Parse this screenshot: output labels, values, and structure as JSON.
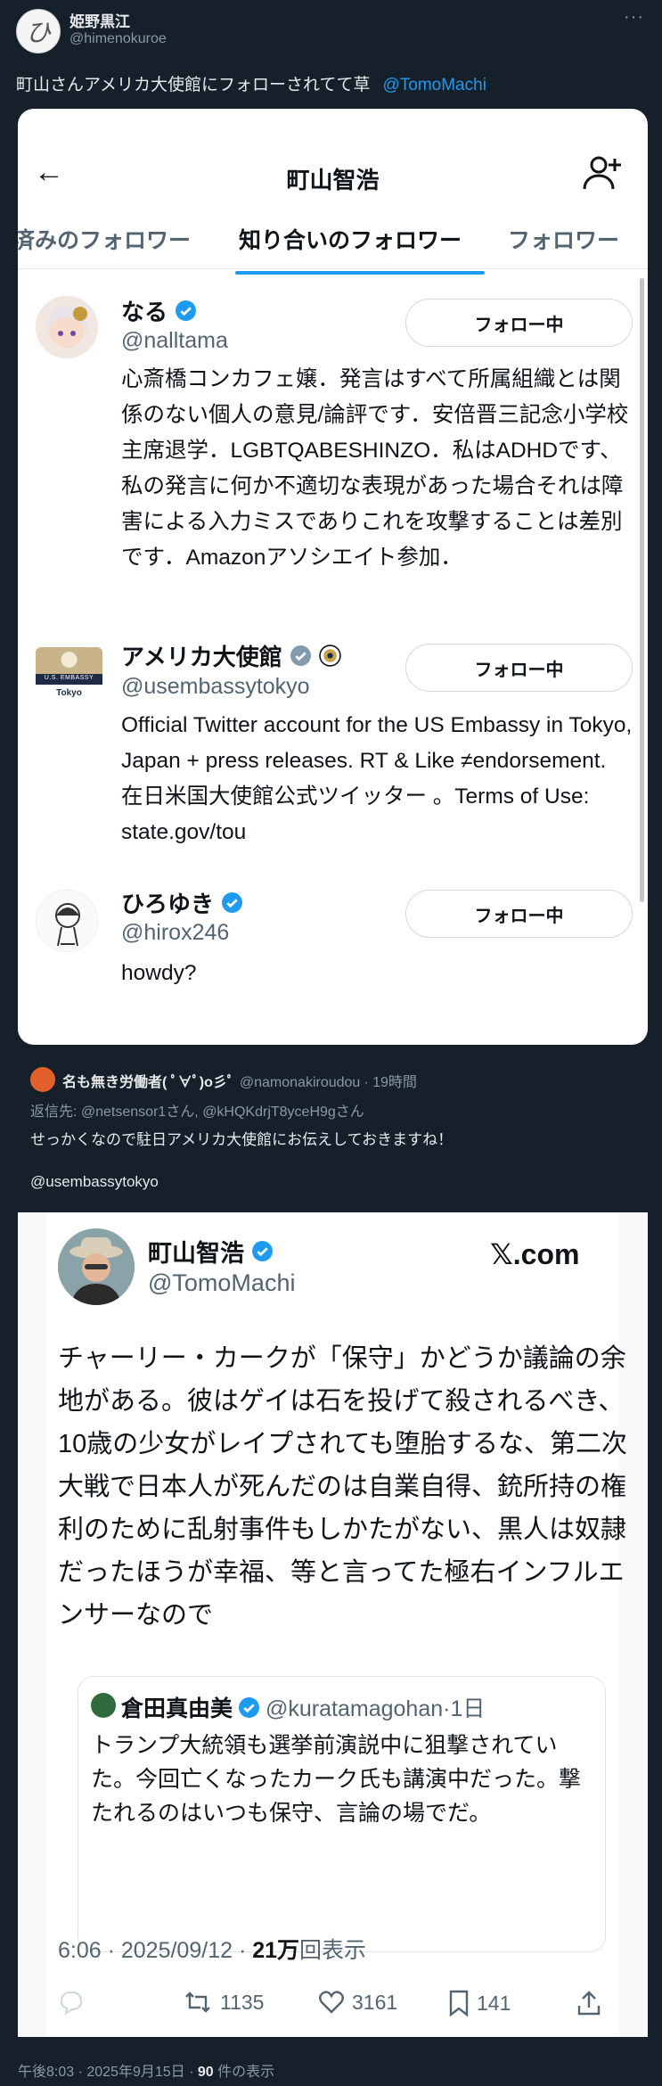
{
  "post": {
    "author_name": "姫野黒江",
    "author_handle": "@himenokuroe",
    "avatar_glyph": "ひ",
    "more": "···",
    "text": "町山さんアメリカ大使館にフォローされてて草",
    "mention": "@TomoMachi"
  },
  "screenshot1": {
    "title": "町山智浩",
    "back_icon": "←",
    "tabs": [
      "済みのフォロワー",
      "知り合いのフォロワー",
      "フォロワー"
    ],
    "accounts": [
      {
        "name": "なる",
        "handle": "@nalltama",
        "button": "フォロー中",
        "bio": "心斎橋コンカフェ嬢．発言はすべて所属組織とは関係のない個人の意見/論評です．安倍晋三記念小学校主席退学．LGBTQABESHINZO．私はADHDです、私の発言に何か不適切な表現があった場合それは障害による入力ミスでありこれを攻撃することは差別です．Amazonアソシエイト参加．"
      },
      {
        "name": "アメリカ大使館",
        "handle": "@usembassytokyo",
        "button": "フォロー中",
        "avatar_text": "U.S. EMBASSY",
        "avatar_sub": "Tokyo",
        "bio": "Official Twitter account for the US Embassy in Tokyo, Japan + press releases. RT & Like ≠endorsement. 在日米国大使館公式ツイッター 。Terms of Use: state.gov/tou"
      },
      {
        "name": "ひろゆき",
        "handle": "@hirox246",
        "button": "フォロー中",
        "bio": "howdy?"
      }
    ]
  },
  "reply": {
    "author_name": "名も無き労働者( ﾟ∀ﾟ)o彡ﾟ",
    "author_handle": "@namonakiroudou",
    "time": "· 19時間",
    "reply_to": "返信先: @netsensor1さん, @kHQKdrjT8yceH9gさん",
    "text": "せっかくなので駐日アメリカ大使館にお伝えしておきますね！",
    "mention": "@usembassytokyo"
  },
  "screenshot2": {
    "name": "町山智浩",
    "handle": "@TomoMachi",
    "brand": "𝕏.com",
    "body": "チャーリー・カークが「保守」かどうか議論の余地がある。彼はゲイは石を投げて殺されるべき、10歳の少女がレイプされても堕胎するな、第二次大戦で日本人が死んだのは自業自得、銃所持の権利のために乱射事件もしかたがない、黒人は奴隷だったほうが幸福、等と言ってた極右インフルエンサーなので",
    "quote": {
      "name": "倉田真由美",
      "handle": "@kuratamagohan·1日",
      "body": "トランプ大統領も選挙前演説中に狙撃されていた。今回亡くなったカーク氏も講演中だった。撃たれるのはいつも保守、言論の場でだ。"
    },
    "time": "6:06 · 2025/09/12 · ",
    "views_count": "21万",
    "views_label": "回表示",
    "retweets": "1135",
    "likes": "3161",
    "bookmarks": "141"
  },
  "footer": {
    "time": "午後8:03 · 2025年9月15日 · ",
    "views": "90",
    "views_label": " 件の表示"
  }
}
